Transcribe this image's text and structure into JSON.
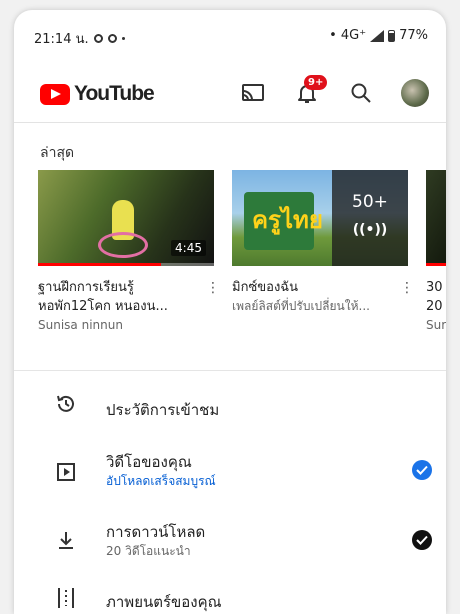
{
  "status_bar": {
    "time": "21:14 น.",
    "network": "• 4G⁺",
    "battery": "77%"
  },
  "app": {
    "name": "YouTube",
    "notification_badge": "9+",
    "brand_color": "#ff0000"
  },
  "icons": {
    "cast": "cast-icon",
    "notifications": "bell-icon",
    "search": "search-icon",
    "history": "history-icon",
    "your_videos": "play-square-icon",
    "downloads": "download-icon",
    "movies": "film-icon"
  },
  "recent": {
    "heading": "ล่าสุด",
    "items": [
      {
        "title_line1": "ฐานฝึกการเรียนรู้",
        "title_line2": "หอพัก12โคก หนองน...",
        "channel": "Sunisa ninnun",
        "duration": "4:45",
        "progress": 0.7
      },
      {
        "title_line1": "มิกซ์ของฉัน",
        "subtitle": "เพลย์ลิสต์ที่ปรับเปลี่ยนให้...",
        "count": "50+",
        "thumb_text": "ครูไทย"
      },
      {
        "title_line1": "30",
        "title_line2": "20",
        "channel": "Sur"
      }
    ]
  },
  "library": [
    {
      "label": "ประวัติการเข้าชม"
    },
    {
      "label": "วิดีโอของคุณ",
      "sub": "อัปโหลดเสร็จสมบูรณ์",
      "sub_color": "#065fd4",
      "check_color": "#1a73e8"
    },
    {
      "label": "การดาวน์โหลด",
      "sub": "20 วิดีโอแนะนำ",
      "sub_color": "#666666",
      "check_color": "#111111"
    },
    {
      "label": "ภาพยนตร์ของคุณ"
    }
  ]
}
